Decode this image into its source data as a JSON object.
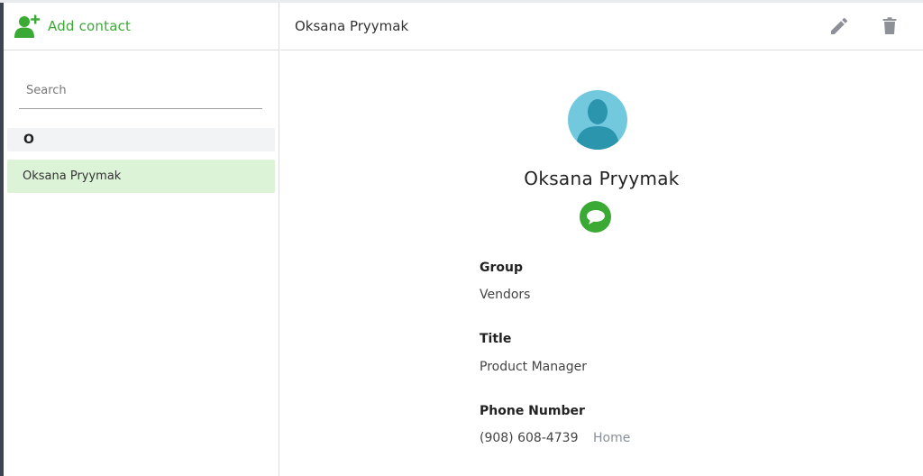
{
  "sidebar": {
    "add_contact_label": "Add contact",
    "search_placeholder": "Search",
    "group_letter": "O",
    "contacts": [
      {
        "name": "Oksana Pryymak",
        "selected": true
      }
    ]
  },
  "detail": {
    "header_name": "Oksana Pryymak",
    "full_name": "Oksana Pryymak",
    "fields": {
      "group": {
        "label": "Group",
        "value": "Vendors"
      },
      "title": {
        "label": "Title",
        "value": "Product Manager"
      },
      "phone": {
        "label": "Phone Number",
        "value": "(908) 608-4739",
        "type": "Home"
      }
    }
  },
  "icons": {
    "add_contact": "add-person-icon",
    "edit": "pencil-icon",
    "delete": "trash-icon",
    "chat": "chat-bubble-icon",
    "avatar": "person-silhouette"
  },
  "colors": {
    "accent_green": "#3aaa35",
    "selected_row": "#ddf3d8",
    "avatar_bg": "#72c9de",
    "avatar_figure": "#2a95ad",
    "icon_gray": "#8d9197"
  }
}
